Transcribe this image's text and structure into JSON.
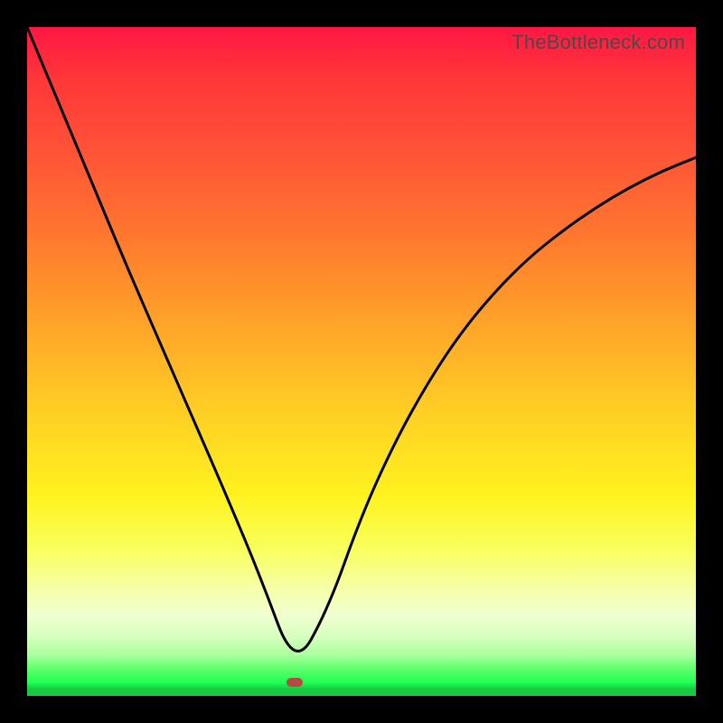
{
  "watermark": "TheBottleneck.com",
  "colors": {
    "frame": "#000000",
    "curve": "#000000",
    "dot": "#b34a44"
  },
  "chart_data": {
    "type": "line",
    "title": "",
    "xlabel": "",
    "ylabel": "",
    "xlim": [
      0,
      100
    ],
    "ylim": [
      0,
      100
    ],
    "grid": false,
    "legend": false,
    "notes": "V-shaped curve over vertical rainbow gradient (red top → green bottom). Curve minimum near x≈40. Drawn without numeric tick labels; values estimated from geometry.",
    "x": [
      0,
      5,
      10,
      15,
      20,
      25,
      30,
      35,
      40,
      45,
      50,
      55,
      60,
      65,
      70,
      75,
      80,
      85,
      90,
      95,
      100
    ],
    "values": [
      100,
      88,
      76,
      64,
      52.5,
      41,
      29.5,
      17.5,
      4,
      13,
      27,
      38,
      47,
      54.5,
      60.5,
      65.5,
      69.5,
      73,
      76,
      78.5,
      80.5
    ],
    "min_point": {
      "x": 40,
      "y": 2
    }
  }
}
